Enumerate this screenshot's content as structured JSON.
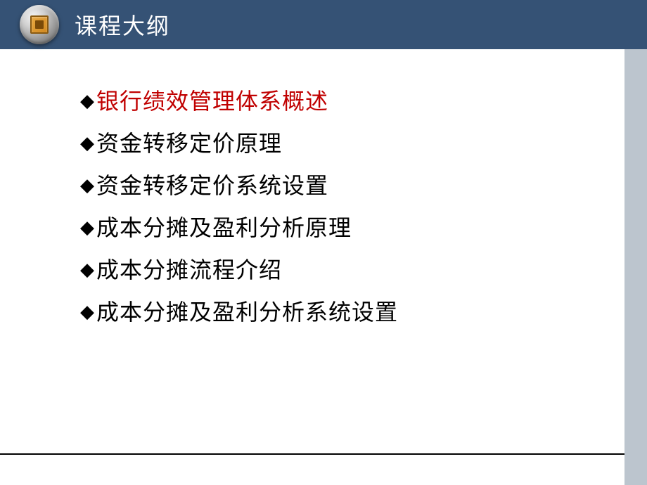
{
  "header": {
    "title": "课程大纲"
  },
  "outline": {
    "bullet": "◆",
    "items": [
      {
        "text": "银行绩效管理体系概述",
        "highlight": true
      },
      {
        "text": "资金转移定价原理",
        "highlight": false
      },
      {
        "text": "资金转移定价系统设置",
        "highlight": false
      },
      {
        "text": "成本分摊及盈利分析原理",
        "highlight": false
      },
      {
        "text": "成本分摊流程介绍",
        "highlight": false
      },
      {
        "text": "成本分摊及盈利分析系统设置",
        "highlight": false
      }
    ]
  }
}
